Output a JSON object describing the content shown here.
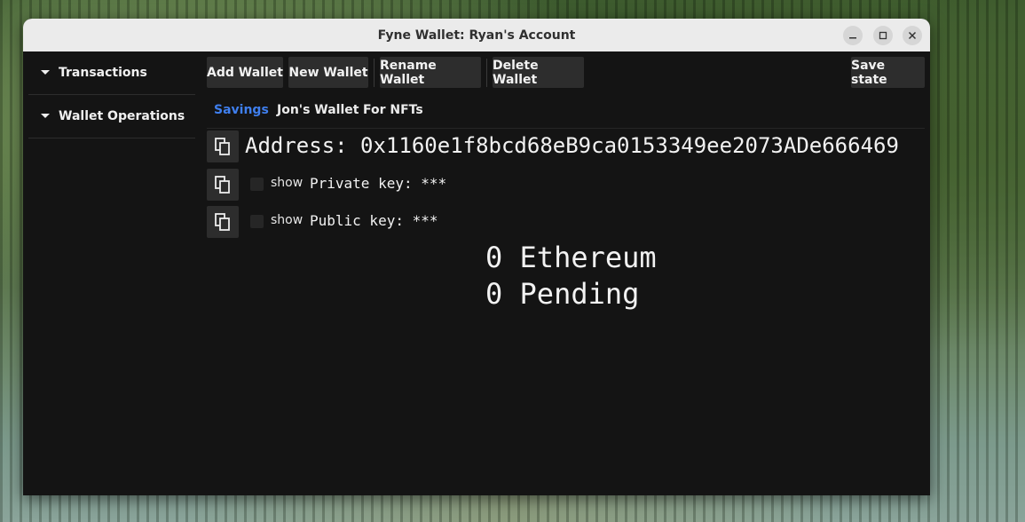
{
  "window": {
    "title": "Fyne Wallet: Ryan's Account",
    "controls": [
      "minimize-icon",
      "maximize-icon",
      "close-icon"
    ]
  },
  "sidebar": {
    "items": [
      {
        "label": "Transactions",
        "icon": "caret-down-icon"
      },
      {
        "label": "Wallet Operations",
        "icon": "caret-down-icon"
      }
    ]
  },
  "toolbar": {
    "add_wallet": "Add Wallet",
    "new_wallet": "New Wallet",
    "rename_wallet": "Rename Wallet",
    "delete_wallet": "Delete Wallet",
    "save_state": "Save state"
  },
  "tabs": [
    {
      "label": "Savings",
      "active": true
    },
    {
      "label": "Jon's Wallet",
      "active": false
    },
    {
      "label": "For NFTs",
      "active": false
    }
  ],
  "wallet": {
    "address_line": "Address: 0x1160e1f8bcd68eB9ca0153349ee2073ADe666469",
    "show_label": "show",
    "private_key_line": "Private key: ***",
    "public_key_line": "Public key: ***",
    "ethereum_line": "0 Ethereum",
    "pending_line": "0 Pending"
  },
  "colors": {
    "accent": "#3f7fee",
    "window_bg": "#141414",
    "button_bg": "#2d2d2d",
    "titlebar_bg": "#ebebeb"
  }
}
